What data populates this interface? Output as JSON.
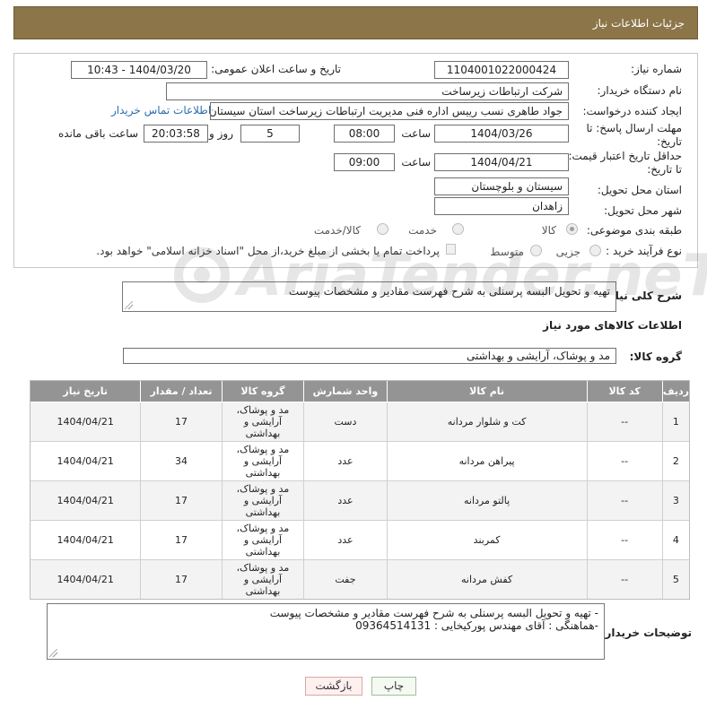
{
  "header": {
    "title": "جزئیات اطلاعات نیاز"
  },
  "form": {
    "need_number_label": "شماره نیاز:",
    "need_number": "1104001022000424",
    "announce_label": "تاریخ و ساعت اعلان عمومی:",
    "announce_value": "1404/03/20 - 10:43",
    "buyer_org_label": "نام دستگاه خریدار:",
    "buyer_org": "شرکت ارتباطات زیرساخت",
    "creator_label": "ایجاد کننده درخواست:",
    "creator": "جواد طاهری نسب رییس اداره فنی مدیریت ارتباطات زیرساخت استان سیستان و",
    "contact_link": "اطلاعات تماس خریدار",
    "deadline_label_1": "مهلت ارسال پاسخ: تا",
    "deadline_label_2": "تاریخ:",
    "deadline_date": "1404/03/26",
    "time_label": "ساعت",
    "deadline_time": "08:00",
    "days_value": "5",
    "days_label": "روز و",
    "remaining_time": "20:03:58",
    "remaining_label": "ساعت باقی مانده",
    "min_validity_label_1": "حداقل تاریخ اعتبار قیمت:",
    "min_validity_label_2": "تا تاریخ:",
    "validity_date": "1404/04/21",
    "validity_time_label": "ساعت",
    "validity_time": "09:00",
    "province_label": "استان محل تحویل:",
    "province": "سیستان و بلوچستان",
    "city_label": "شهر محل تحویل:",
    "city": "زاهدان",
    "category_label": "طبقه بندی موضوعی:",
    "category_options": [
      "کالا",
      "خدمت",
      "کالا/خدمت"
    ],
    "category_selected": "کالا",
    "process_label": "نوع فرآیند خرید :",
    "process_options": [
      "جزیی",
      "متوسط"
    ],
    "payment_note": "پرداخت تمام یا بخشی از مبلغ خرید،از محل \"اسناد خزانه اسلامی\" خواهد بود."
  },
  "description": {
    "label": "شرح کلی نیاز:",
    "value": "تهیه و تحویل البسه پرسنلی به شرح فهرست مقادیر و مشخصات پیوست"
  },
  "goods_section": {
    "title": "اطلاعات کالاهای مورد نیاز",
    "group_label": "گروه کالا:",
    "group_value": "مد و پوشاک، آرایشی و بهداشتی"
  },
  "table": {
    "headers": [
      "ردیف",
      "کد کالا",
      "نام کالا",
      "واحد شمارش",
      "گروه کالا",
      "تعداد / مقدار",
      "تاریخ نیاز"
    ],
    "rows": [
      {
        "row": "1",
        "code": "--",
        "name": "کت و شلوار مردانه",
        "unit": "دست",
        "group": "مد و پوشاک، آرایشی و بهداشتی",
        "qty": "17",
        "date": "1404/04/21"
      },
      {
        "row": "2",
        "code": "--",
        "name": "پیراهن مردانه",
        "unit": "عدد",
        "group": "مد و پوشاک، آرایشی و بهداشتی",
        "qty": "34",
        "date": "1404/04/21"
      },
      {
        "row": "3",
        "code": "--",
        "name": "پالتو مردانه",
        "unit": "عدد",
        "group": "مد و پوشاک، آرایشی و بهداشتی",
        "qty": "17",
        "date": "1404/04/21"
      },
      {
        "row": "4",
        "code": "--",
        "name": "کمربند",
        "unit": "عدد",
        "group": "مد و پوشاک، آرایشی و بهداشتی",
        "qty": "17",
        "date": "1404/04/21"
      },
      {
        "row": "5",
        "code": "--",
        "name": "کفش مردانه",
        "unit": "جفت",
        "group": "مد و پوشاک، آرایشی و بهداشتی",
        "qty": "17",
        "date": "1404/04/21"
      }
    ]
  },
  "buyer_notes": {
    "label": "توضیحات خریدار:",
    "line1": "- تهیه و تحویل البسه پرسنلی به شرح فهرست مقادیر و مشخصات پیوست",
    "line2": "-هماهنگی : آقای مهندس پورکیخایی : 09364514131"
  },
  "buttons": {
    "print": "چاپ",
    "back": "بازگشت"
  },
  "watermark": {
    "text": "AriaTender.neT"
  },
  "colors": {
    "title_bar": "#8c7548",
    "table_header": "#949494",
    "link": "#2a6fb0"
  }
}
